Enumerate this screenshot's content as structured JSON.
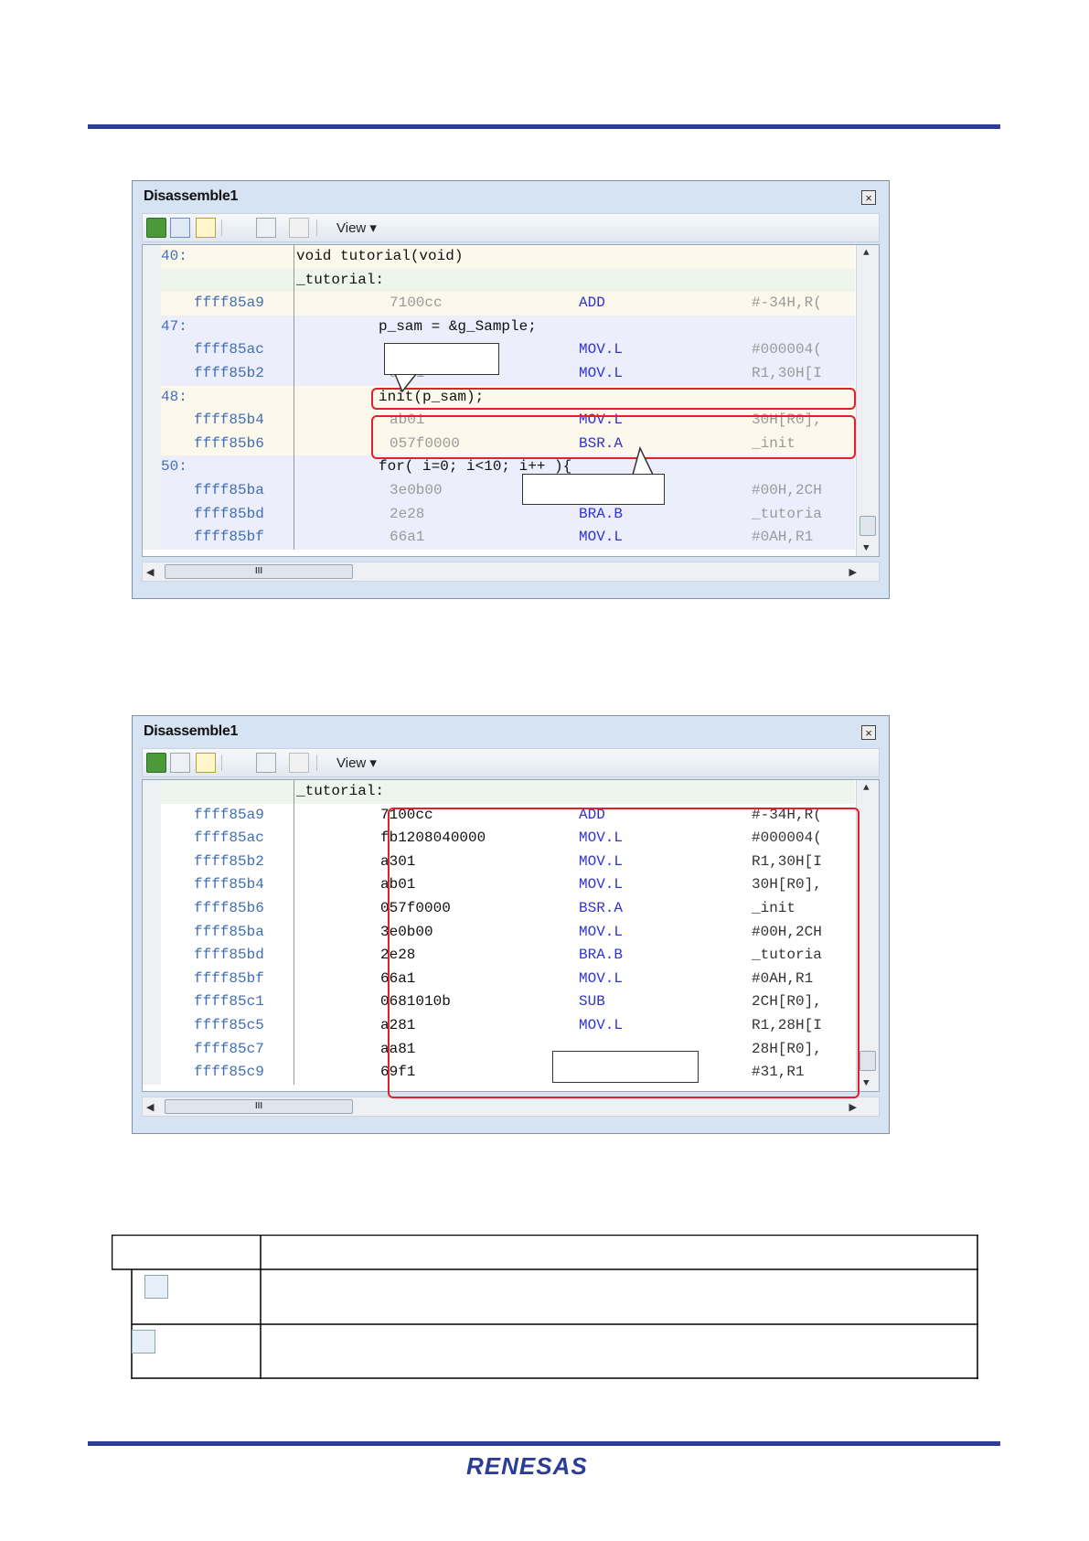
{
  "win1": {
    "title": "Disassemble1",
    "view_label": "View",
    "rows": [
      {
        "kind": "src",
        "line": "40:",
        "code": "void tutorial(void)",
        "bg": "#fdf8ec"
      },
      {
        "kind": "label",
        "code": "_tutorial:",
        "bg": "#eef6ec"
      },
      {
        "kind": "asm",
        "addr": "ffff85a9",
        "bytes": "7100cc",
        "mn": "ADD",
        "op": "#-34H,R(",
        "bg": "#fdf8ec"
      },
      {
        "kind": "src",
        "line": "47:",
        "code": "p_sam = &g_Sample;",
        "bg": "#eceefc"
      },
      {
        "kind": "asm",
        "addr": "ffff85ac",
        "bytes": "000",
        "mn": "MOV.L",
        "op": "#000004(",
        "bg": "#eceefc"
      },
      {
        "kind": "asm",
        "addr": "ffff85b2",
        "bytes": "a301",
        "mn": "MOV.L",
        "op": "R1,30H[I",
        "bg": "#eceefc"
      },
      {
        "kind": "src",
        "line": "48:",
        "code": "init(p_sam);",
        "bg": "#fdf8ec"
      },
      {
        "kind": "asm",
        "addr": "ffff85b4",
        "bytes": "ab01",
        "mn": "MOV.L",
        "op": "30H[R0],",
        "bg": "#fdf8ec"
      },
      {
        "kind": "asm",
        "addr": "ffff85b6",
        "bytes": "057f0000",
        "mn": "BSR.A",
        "op": "_init",
        "bg": "#fdf8ec"
      },
      {
        "kind": "src",
        "line": "50:",
        "code": "for( i=0; i<10; i++ ){",
        "bg": "#eceefc"
      },
      {
        "kind": "asm",
        "addr": "ffff85ba",
        "bytes": "3e0b00",
        "mn": "MOV.L",
        "op": "#00H,2CH",
        "bg": "#eceefc"
      },
      {
        "kind": "asm",
        "addr": "ffff85bd",
        "bytes": "2e28",
        "mn": "BRA.B",
        "op": "_tutoria",
        "bg": "#eceefc"
      },
      {
        "kind": "asm",
        "addr": "ffff85bf",
        "bytes": "66a1",
        "mn": "MOV.L",
        "op": "#0AH,R1",
        "bg": "#eceefc"
      }
    ]
  },
  "win2": {
    "title": "Disassemble1",
    "view_label": "View",
    "label_row": "_tutorial:",
    "rows": [
      {
        "addr": "ffff85a9",
        "bytes": "7100cc",
        "mn": "ADD",
        "op": "#-34H,R("
      },
      {
        "addr": "ffff85ac",
        "bytes": "fb1208040000",
        "mn": "MOV.L",
        "op": "#000004("
      },
      {
        "addr": "ffff85b2",
        "bytes": "a301",
        "mn": "MOV.L",
        "op": "R1,30H[I"
      },
      {
        "addr": "ffff85b4",
        "bytes": "ab01",
        "mn": "MOV.L",
        "op": "30H[R0],"
      },
      {
        "addr": "ffff85b6",
        "bytes": "057f0000",
        "mn": "BSR.A",
        "op": "_init"
      },
      {
        "addr": "ffff85ba",
        "bytes": "3e0b00",
        "mn": "MOV.L",
        "op": "#00H,2CH"
      },
      {
        "addr": "ffff85bd",
        "bytes": "2e28",
        "mn": "BRA.B",
        "op": "_tutoria"
      },
      {
        "addr": "ffff85bf",
        "bytes": "66a1",
        "mn": "MOV.L",
        "op": "#0AH,R1"
      },
      {
        "addr": "ffff85c1",
        "bytes": "0681010b",
        "mn": "SUB",
        "op": "2CH[R0],"
      },
      {
        "addr": "ffff85c5",
        "bytes": "a281",
        "mn": "MOV.L",
        "op": "R1,28H[I"
      },
      {
        "addr": "ffff85c7",
        "bytes": "aa81",
        "mn": "",
        "op": "28H[R0],"
      },
      {
        "addr": "ffff85c9",
        "bytes": "69f1",
        "mn": "",
        "op": "#31,R1"
      }
    ]
  },
  "scroll_mark": "III",
  "logo": "RENESAS",
  "colors": {
    "rule": "#2b3d96",
    "highlight": "#e0202a",
    "mnemonic": "#2f33d4",
    "address": "#3f6fb6"
  }
}
